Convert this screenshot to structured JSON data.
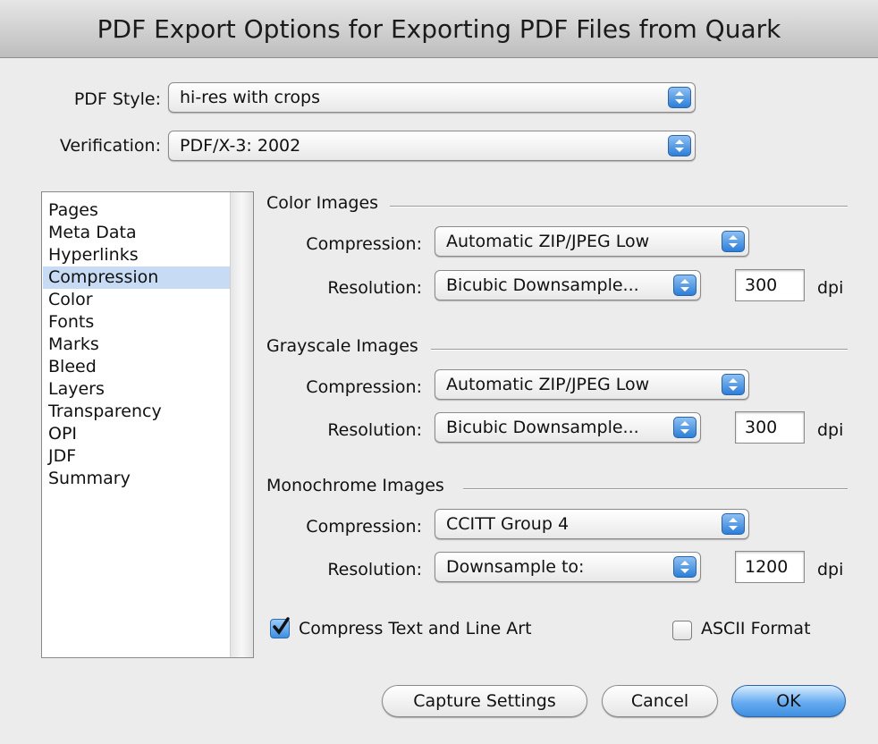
{
  "window": {
    "title": "PDF Export Options for Exporting PDF Files from Quark"
  },
  "top": {
    "pdf_style_label": "PDF Style:",
    "pdf_style_value": "hi-res with crops",
    "verification_label": "Verification:",
    "verification_value": "PDF/X-3: 2002"
  },
  "sidebar": {
    "items": [
      {
        "label": "Pages"
      },
      {
        "label": "Meta Data"
      },
      {
        "label": "Hyperlinks"
      },
      {
        "label": "Compression"
      },
      {
        "label": "Color"
      },
      {
        "label": "Fonts"
      },
      {
        "label": "Marks"
      },
      {
        "label": "Bleed"
      },
      {
        "label": "Layers"
      },
      {
        "label": "Transparency"
      },
      {
        "label": "OPI"
      },
      {
        "label": "JDF"
      },
      {
        "label": "Summary"
      }
    ],
    "selected": "Compression"
  },
  "color_images": {
    "heading": "Color Images",
    "compression_label": "Compression:",
    "compression_value": "Automatic ZIP/JPEG Low",
    "resolution_label": "Resolution:",
    "resolution_value": "Bicubic Downsample...",
    "dpi_value": "300",
    "dpi_unit": "dpi"
  },
  "grayscale_images": {
    "heading": "Grayscale Images",
    "compression_label": "Compression:",
    "compression_value": "Automatic ZIP/JPEG Low",
    "resolution_label": "Resolution:",
    "resolution_value": "Bicubic Downsample...",
    "dpi_value": "300",
    "dpi_unit": "dpi"
  },
  "monochrome_images": {
    "heading": "Monochrome Images",
    "compression_label": "Compression:",
    "compression_value": "CCITT Group 4",
    "resolution_label": "Resolution:",
    "resolution_value": "Downsample to:",
    "dpi_value": "1200",
    "dpi_unit": "dpi"
  },
  "options": {
    "compress_text_label": "Compress Text and Line Art",
    "compress_text_checked": true,
    "ascii_label": "ASCII Format",
    "ascii_checked": false
  },
  "buttons": {
    "capture": "Capture Settings",
    "cancel": "Cancel",
    "ok": "OK"
  },
  "icons": {
    "popup_arrows": "updown-arrows-icon",
    "checkmark": "checkmark-icon"
  },
  "colors": {
    "accent": "#3f8fe0",
    "selection": "#c7dcf4"
  }
}
